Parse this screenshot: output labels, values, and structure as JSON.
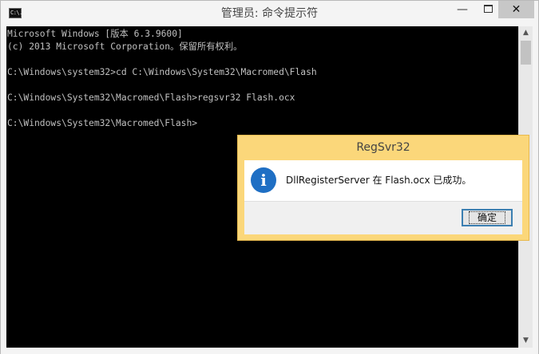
{
  "window": {
    "title": "管理员: 命令提示符",
    "icon_label": "C:\\.",
    "icons": {
      "app": "console-icon",
      "minimize": "minimize-icon",
      "maximize": "maximize-icon",
      "close": "close-icon"
    },
    "minimize_glyph": "—",
    "close_glyph": "✕"
  },
  "console": {
    "lines": [
      "Microsoft Windows [版本 6.3.9600]",
      "(c) 2013 Microsoft Corporation。保留所有权利。",
      "",
      "C:\\Windows\\system32>cd C:\\Windows\\System32\\Macromed\\Flash",
      "",
      "C:\\Windows\\System32\\Macromed\\Flash>regsvr32 Flash.ocx",
      "",
      "C:\\Windows\\System32\\Macromed\\Flash>"
    ],
    "colors": {
      "background": "#000000",
      "text": "#c0c0c0"
    }
  },
  "scrollbar": {
    "up_glyph": "▲",
    "down_glyph": "▼"
  },
  "dialog": {
    "title": "RegSvr32",
    "icon": "info-icon",
    "icon_glyph": "i",
    "message": "DllRegisterServer 在 Flash.ocx 已成功。",
    "ok_label": "确定",
    "colors": {
      "frame": "#fbd77a",
      "icon": "#1f6fc4"
    }
  }
}
